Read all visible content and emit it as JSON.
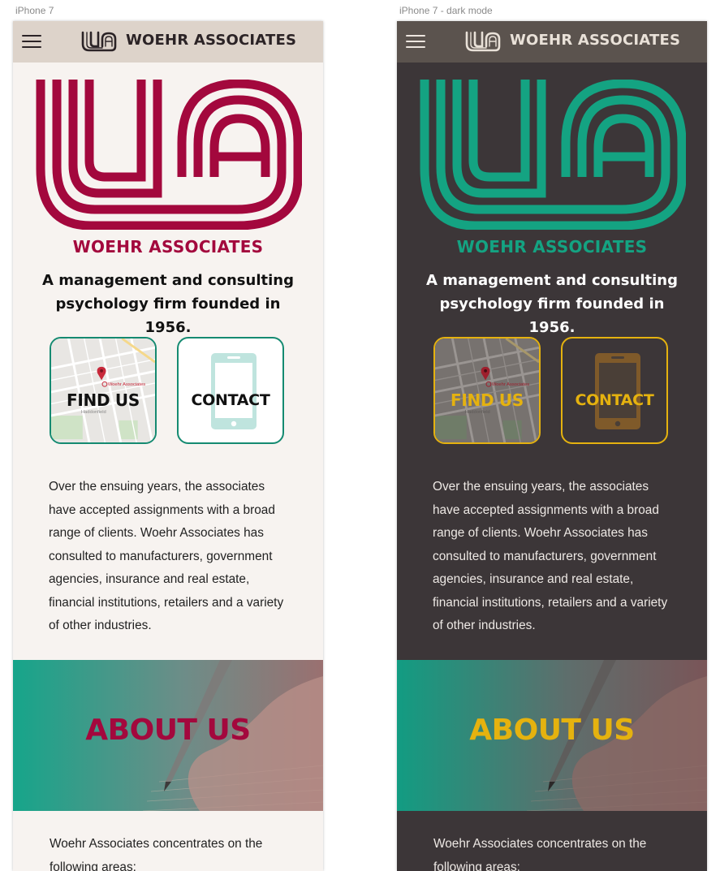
{
  "light": {
    "label": "iPhone 7",
    "brand": "WOEHR ASSOCIATES",
    "logo_word": "WOEHR ASSOCIATES",
    "tagline": "A management and consulting psychology firm founded in 1956.",
    "find_us": "FIND US",
    "contact": "CONTACT",
    "map_pin_label": "Woehr Associates",
    "map_town_label": "Haddonfield",
    "body": "Over the ensuing years, the associates have accepted assignments with a broad range of clients.  Woehr Associates has consulted to manufacturers, government agencies, insurance and real estate, financial institutions, retailers and a variety of other industries.",
    "banner_title": "ABOUT US",
    "areas_intro": "Woehr Associates concentrates on the following areas:"
  },
  "dark": {
    "label": "iPhone 7 - dark mode",
    "brand": "WOEHR ASSOCIATES",
    "logo_word": "WOEHR ASSOCIATES",
    "tagline": "A management and consulting psychology firm founded in 1956.",
    "find_us": "FIND US",
    "contact": "CONTACT",
    "map_pin_label": "Woehr Associates",
    "map_town_label": "Haddonfield",
    "body": "Over the ensuing years, the associates have accepted assignments with a broad range of clients.  Woehr Associates has consulted to manufacturers, government agencies, insurance and real estate, financial institutions, retailers and a variety of other industries.",
    "banner_title": "ABOUT US",
    "areas_intro": "Woehr Associates concentrates on the following areas:"
  },
  "colors": {
    "light_accent": "#a3083d",
    "light_tile_border": "#158a71",
    "dark_accent": "#14a382",
    "dark_highlight": "#e5b20f",
    "light_background": "#f7f3f0",
    "dark_background": "#3c3638"
  },
  "icons": [
    "menu-icon",
    "wa-logo-icon",
    "map-pin-icon",
    "phone-icon"
  ]
}
